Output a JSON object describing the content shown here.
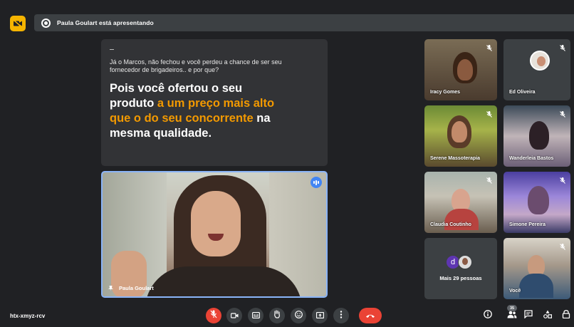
{
  "top": {
    "presenting_text": "Paula Goulart está apresentando"
  },
  "slide": {
    "intro": "Já o Marcos, não fechou e você perdeu a chance de ser seu fornecedor de brigadeiros.. e por que?",
    "headline_part1": "Pois você ofertou o seu produto ",
    "headline_highlight1": "a um preço mais alto que o do seu concorrente",
    "headline_part2": " na mesma qualidade."
  },
  "speaker": {
    "name": "Paula Goulart"
  },
  "participants": [
    {
      "name": "Iracy Gomes"
    },
    {
      "name": "Ed Oliveira"
    },
    {
      "name": "Serene Massoterapia"
    },
    {
      "name": "Wanderleia Bastos"
    },
    {
      "name": "Claudia Coutinho"
    },
    {
      "name": "Simone Pereira"
    }
  ],
  "more": {
    "initial": "d",
    "label": "Mais 29 pessoas"
  },
  "self": {
    "name": "Você"
  },
  "bottom": {
    "meeting_code": "htx-xmyz-rcv",
    "participant_count": "35"
  },
  "colors": {
    "background": "#202124",
    "accent": "#8ab4f8",
    "highlight": "#f29900",
    "danger": "#ea4335",
    "warning": "#f5b400"
  },
  "icons": {
    "camera_off": "camera-off-icon",
    "present": "present-icon",
    "mic_off": "mic-off-icon",
    "captions": "captions-icon",
    "hand": "raise-hand-icon",
    "emoji": "emoji-icon",
    "present_screen": "present-screen-icon",
    "more": "more-options-icon",
    "end_call": "end-call-icon",
    "info": "info-icon",
    "people": "people-icon",
    "chat": "chat-icon",
    "activities": "activities-icon",
    "lock": "lock-icon"
  }
}
